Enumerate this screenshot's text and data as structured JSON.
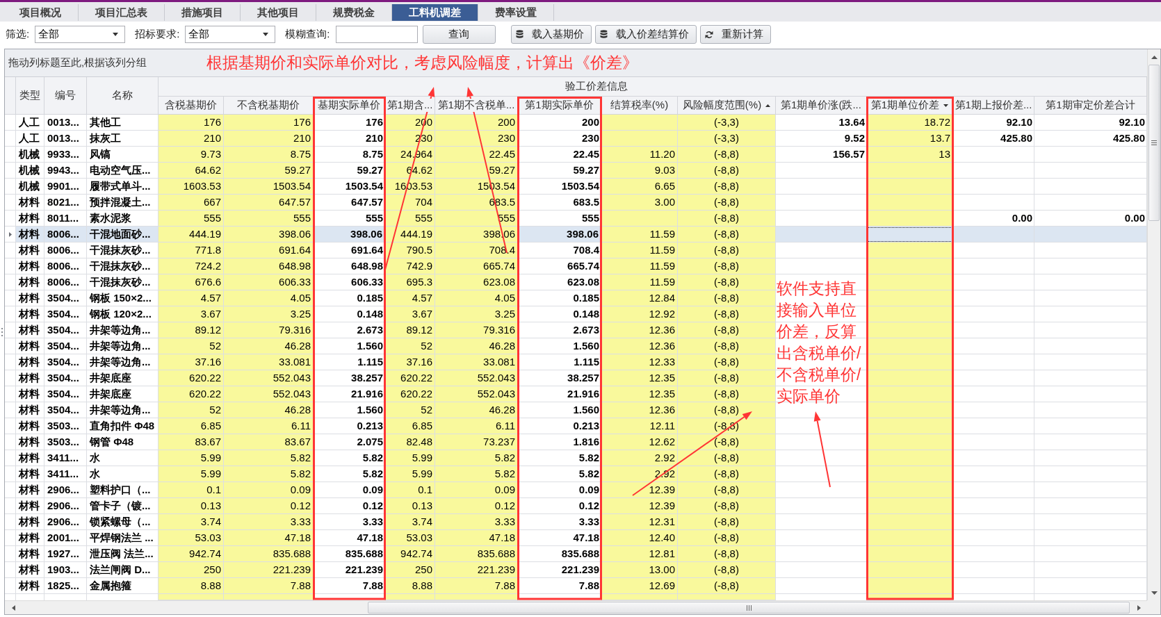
{
  "tabs": [
    {
      "label": "项目概况",
      "selected": false
    },
    {
      "label": "项目汇总表",
      "selected": false
    },
    {
      "label": "措施项目",
      "selected": false
    },
    {
      "label": "其他项目",
      "selected": false
    },
    {
      "label": "规费税金",
      "selected": false
    },
    {
      "label": "工料机调差",
      "selected": true
    },
    {
      "label": "费率设置",
      "selected": false
    }
  ],
  "toolbar": {
    "filters": [
      {
        "label": "筛选:",
        "value": "全部"
      },
      {
        "label": "招标要求:",
        "value": "全部"
      }
    ],
    "search": {
      "label": "模糊查询:"
    },
    "search_button": "查询",
    "actions": [
      {
        "label": "载入基期价",
        "kind": "load"
      },
      {
        "label": "载入价差结算价",
        "kind": "load"
      },
      {
        "label": "重新计算",
        "kind": "recalculate"
      }
    ]
  },
  "annotations": [
    {
      "kind": "headline",
      "text": "根据基期价和实际单价对比，考虑风险幅度，计算出《价差》"
    },
    {
      "kind": "callout",
      "text": "软件支持直接输入单位价差，反算出含税单价/不含税单价/实际单价"
    }
  ],
  "table": {
    "group_panel": "拖动列标题至此,根据该列分组",
    "band": "验工价差信息",
    "columns": [
      {
        "label": "类型",
        "banded": false,
        "kind": "text",
        "editable": false,
        "sort_ascending": false,
        "sort_descending": false,
        "highlighted": false,
        "focused": false
      },
      {
        "label": "编号",
        "banded": false,
        "kind": "text",
        "editable": false,
        "sort_ascending": false,
        "sort_descending": false,
        "highlighted": false,
        "focused": false
      },
      {
        "label": "名称",
        "banded": false,
        "kind": "text",
        "editable": false,
        "sort_ascending": false,
        "sort_descending": false,
        "highlighted": false,
        "focused": false
      },
      {
        "label": "含税基期价",
        "banded": true,
        "kind": "number",
        "editable": true,
        "sort_ascending": false,
        "sort_descending": false,
        "highlighted": false,
        "focused": false
      },
      {
        "label": "不含税基期价",
        "banded": true,
        "kind": "number",
        "editable": true,
        "sort_ascending": false,
        "sort_descending": false,
        "highlighted": false,
        "focused": false
      },
      {
        "label": "基期实际单价",
        "banded": true,
        "kind": "number",
        "editable": false,
        "sort_ascending": false,
        "sort_descending": false,
        "highlighted": true,
        "focused": false
      },
      {
        "label": "第1期含...",
        "banded": true,
        "kind": "number",
        "editable": true,
        "sort_ascending": false,
        "sort_descending": false,
        "highlighted": false,
        "focused": false
      },
      {
        "label": "第1期不含税单...",
        "banded": true,
        "kind": "number",
        "editable": true,
        "sort_ascending": false,
        "sort_descending": false,
        "highlighted": false,
        "focused": false
      },
      {
        "label": "第1期实际单价",
        "banded": true,
        "kind": "number",
        "editable": false,
        "sort_ascending": false,
        "sort_descending": false,
        "highlighted": true,
        "focused": false
      },
      {
        "label": "结算税率(%)",
        "banded": true,
        "kind": "number",
        "editable": true,
        "sort_ascending": false,
        "sort_descending": false,
        "highlighted": false,
        "focused": false
      },
      {
        "label": "风险幅度范围(%)",
        "banded": true,
        "kind": "range",
        "editable": true,
        "sort_ascending": true,
        "sort_descending": false,
        "highlighted": false,
        "focused": false
      },
      {
        "label": "第1期单价涨(跌...",
        "banded": true,
        "kind": "number",
        "editable": false,
        "sort_ascending": false,
        "sort_descending": false,
        "highlighted": false,
        "focused": false
      },
      {
        "label": "第1期单位价差",
        "banded": true,
        "kind": "number",
        "editable": true,
        "sort_ascending": false,
        "sort_descending": true,
        "highlighted": true,
        "focused": true
      },
      {
        "label": "第1期上报价差...",
        "banded": true,
        "kind": "number",
        "editable": false,
        "sort_ascending": false,
        "sort_descending": false,
        "highlighted": false,
        "focused": false
      },
      {
        "label": "第1期审定价差合计",
        "banded": true,
        "kind": "number",
        "editable": false,
        "sort_ascending": false,
        "sort_descending": false,
        "highlighted": false,
        "focused": false
      }
    ],
    "rows": [
      {
        "selected": false,
        "cells": [
          "人工",
          "0013...",
          "其他工",
          "176",
          "176",
          "176",
          "200",
          "200",
          "200",
          null,
          "(-3,3)",
          "13.64",
          "18.72",
          "92.10",
          "92.10"
        ]
      },
      {
        "selected": false,
        "cells": [
          "人工",
          "0013...",
          "抹灰工",
          "210",
          "210",
          "210",
          "230",
          "230",
          "230",
          null,
          "(-3,3)",
          "9.52",
          "13.7",
          "425.80",
          "425.80"
        ]
      },
      {
        "selected": false,
        "cells": [
          "机械",
          "9933...",
          "风镐",
          "9.73",
          "8.75",
          "8.75",
          "24.964",
          "22.45",
          "22.45",
          "11.20",
          "(-8,8)",
          "156.57",
          "13",
          null,
          null
        ]
      },
      {
        "selected": false,
        "cells": [
          "机械",
          "9943...",
          "电动空气压...",
          "64.62",
          "59.27",
          "59.27",
          "64.62",
          "59.27",
          "59.27",
          "9.03",
          "(-8,8)",
          null,
          null,
          null,
          null
        ]
      },
      {
        "selected": false,
        "cells": [
          "机械",
          "9901...",
          "履带式单斗...",
          "1603.53",
          "1503.54",
          "1503.54",
          "1603.53",
          "1503.54",
          "1503.54",
          "6.65",
          "(-8,8)",
          null,
          null,
          null,
          null
        ]
      },
      {
        "selected": false,
        "cells": [
          "材料",
          "8021...",
          "预拌混凝土...",
          "667",
          "647.57",
          "647.57",
          "704",
          "683.5",
          "683.5",
          "3.00",
          "(-8,8)",
          null,
          null,
          null,
          null
        ]
      },
      {
        "selected": false,
        "cells": [
          "材料",
          "8011...",
          "素水泥浆",
          "555",
          "555",
          "555",
          "555",
          "555",
          "555",
          null,
          "(-8,8)",
          null,
          null,
          "0.00",
          "0.00"
        ]
      },
      {
        "selected": true,
        "cells": [
          "材料",
          "8006...",
          "干混地面砂...",
          "444.19",
          "398.06",
          "398.06",
          "444.19",
          "398.06",
          "398.06",
          "11.59",
          "(-8,8)",
          null,
          null,
          null,
          null
        ]
      },
      {
        "selected": false,
        "cells": [
          "材料",
          "8006...",
          "干混抹灰砂...",
          "771.8",
          "691.64",
          "691.64",
          "790.5",
          "708.4",
          "708.4",
          "11.59",
          "(-8,8)",
          null,
          null,
          null,
          null
        ]
      },
      {
        "selected": false,
        "cells": [
          "材料",
          "8006...",
          "干混抹灰砂...",
          "724.2",
          "648.98",
          "648.98",
          "742.9",
          "665.74",
          "665.74",
          "11.59",
          "(-8,8)",
          null,
          null,
          null,
          null
        ]
      },
      {
        "selected": false,
        "cells": [
          "材料",
          "8006...",
          "干混抹灰砂...",
          "676.6",
          "606.33",
          "606.33",
          "695.3",
          "623.08",
          "623.08",
          "11.59",
          "(-8,8)",
          null,
          null,
          null,
          null
        ]
      },
      {
        "selected": false,
        "cells": [
          "材料",
          "3504...",
          "钢板 150×2...",
          "4.57",
          "4.05",
          "0.185",
          "4.57",
          "4.05",
          "0.185",
          "12.84",
          "(-8,8)",
          null,
          null,
          null,
          null
        ]
      },
      {
        "selected": false,
        "cells": [
          "材料",
          "3504...",
          "钢板 120×2...",
          "3.67",
          "3.25",
          "0.148",
          "3.67",
          "3.25",
          "0.148",
          "12.92",
          "(-8,8)",
          null,
          null,
          null,
          null
        ]
      },
      {
        "selected": false,
        "cells": [
          "材料",
          "3504...",
          "井架等边角...",
          "89.12",
          "79.316",
          "2.673",
          "89.12",
          "79.316",
          "2.673",
          "12.36",
          "(-8,8)",
          null,
          null,
          null,
          null
        ]
      },
      {
        "selected": false,
        "cells": [
          "材料",
          "3504...",
          "井架等边角...",
          "52",
          "46.28",
          "1.560",
          "52",
          "46.28",
          "1.560",
          "12.36",
          "(-8,8)",
          null,
          null,
          null,
          null
        ]
      },
      {
        "selected": false,
        "cells": [
          "材料",
          "3504...",
          "井架等边角...",
          "37.16",
          "33.081",
          "1.115",
          "37.16",
          "33.081",
          "1.115",
          "12.33",
          "(-8,8)",
          null,
          null,
          null,
          null
        ]
      },
      {
        "selected": false,
        "cells": [
          "材料",
          "3504...",
          "井架底座",
          "620.22",
          "552.043",
          "38.257",
          "620.22",
          "552.043",
          "38.257",
          "12.35",
          "(-8,8)",
          null,
          null,
          null,
          null
        ]
      },
      {
        "selected": false,
        "cells": [
          "材料",
          "3504...",
          "井架底座",
          "620.22",
          "552.043",
          "21.916",
          "620.22",
          "552.043",
          "21.916",
          "12.35",
          "(-8,8)",
          null,
          null,
          null,
          null
        ]
      },
      {
        "selected": false,
        "cells": [
          "材料",
          "3504...",
          "井架等边角...",
          "52",
          "46.28",
          "1.560",
          "52",
          "46.28",
          "1.560",
          "12.36",
          "(-8,8)",
          null,
          null,
          null,
          null
        ]
      },
      {
        "selected": false,
        "cells": [
          "材料",
          "3503...",
          "直角扣件 Φ48",
          "6.85",
          "6.11",
          "0.213",
          "6.85",
          "6.11",
          "0.213",
          "12.11",
          "(-8,8)",
          null,
          null,
          null,
          null
        ]
      },
      {
        "selected": false,
        "cells": [
          "材料",
          "3503...",
          "钢管 Φ48",
          "83.67",
          "83.67",
          "2.075",
          "82.48",
          "73.237",
          "1.816",
          "12.62",
          "(-8,8)",
          null,
          null,
          null,
          null
        ]
      },
      {
        "selected": false,
        "cells": [
          "材料",
          "3411...",
          "水",
          "5.99",
          "5.82",
          "5.82",
          "5.99",
          "5.82",
          "5.82",
          "2.92",
          "(-8,8)",
          null,
          null,
          null,
          null
        ]
      },
      {
        "selected": false,
        "cells": [
          "材料",
          "3411...",
          "水",
          "5.99",
          "5.82",
          "5.82",
          "5.99",
          "5.82",
          "5.82",
          "2.92",
          "(-8,8)",
          null,
          null,
          null,
          null
        ]
      },
      {
        "selected": false,
        "cells": [
          "材料",
          "2906...",
          "塑料护口（...",
          "0.1",
          "0.09",
          "0.09",
          "0.1",
          "0.09",
          "0.09",
          "12.39",
          "(-8,8)",
          null,
          null,
          null,
          null
        ]
      },
      {
        "selected": false,
        "cells": [
          "材料",
          "2906...",
          "管卡子（镀...",
          "0.13",
          "0.12",
          "0.12",
          "0.13",
          "0.12",
          "0.12",
          "12.39",
          "(-8,8)",
          null,
          null,
          null,
          null
        ]
      },
      {
        "selected": false,
        "cells": [
          "材料",
          "2906...",
          "锁紧螺母（...",
          "3.74",
          "3.33",
          "3.33",
          "3.74",
          "3.33",
          "3.33",
          "12.31",
          "(-8,8)",
          null,
          null,
          null,
          null
        ]
      },
      {
        "selected": false,
        "cells": [
          "材料",
          "2001...",
          "平焊钢法兰 ...",
          "53.03",
          "47.18",
          "47.18",
          "53.03",
          "47.18",
          "47.18",
          "12.40",
          "(-8,8)",
          null,
          null,
          null,
          null
        ]
      },
      {
        "selected": false,
        "cells": [
          "材料",
          "1927...",
          "泄压阀 法兰...",
          "942.74",
          "835.688",
          "835.688",
          "942.74",
          "835.688",
          "835.688",
          "12.81",
          "(-8,8)",
          null,
          null,
          null,
          null
        ]
      },
      {
        "selected": false,
        "cells": [
          "材料",
          "1903...",
          "法兰闸阀 D...",
          "250",
          "221.239",
          "221.239",
          "250",
          "221.239",
          "221.239",
          "13.00",
          "(-8,8)",
          null,
          null,
          null,
          null
        ]
      },
      {
        "selected": false,
        "cells": [
          "材料",
          "1825...",
          "金属抱箍",
          "8.88",
          "7.88",
          "7.88",
          "8.88",
          "7.88",
          "7.88",
          "12.69",
          "(-8,8)",
          null,
          null,
          null,
          null
        ]
      }
    ]
  }
}
